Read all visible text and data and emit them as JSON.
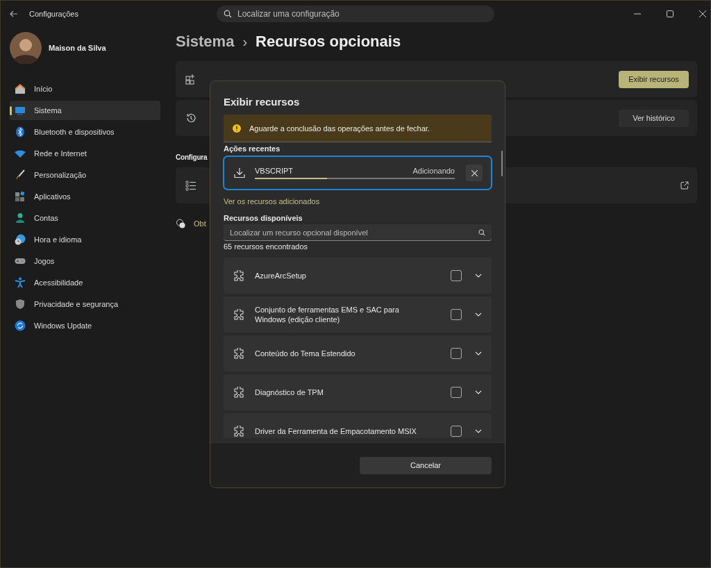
{
  "window": {
    "title": "Configurações",
    "search_placeholder": "Localizar uma configuração"
  },
  "user": {
    "name": "Maison da Silva"
  },
  "nav": [
    {
      "label": "Início",
      "selected": false
    },
    {
      "label": "Sistema",
      "selected": true
    },
    {
      "label": "Bluetooth e dispositivos",
      "selected": false
    },
    {
      "label": "Rede e Internet",
      "selected": false
    },
    {
      "label": "Personalização",
      "selected": false
    },
    {
      "label": "Aplicativos",
      "selected": false
    },
    {
      "label": "Contas",
      "selected": false
    },
    {
      "label": "Hora e idioma",
      "selected": false
    },
    {
      "label": "Jogos",
      "selected": false
    },
    {
      "label": "Acessibilidade",
      "selected": false
    },
    {
      "label": "Privacidade e segurança",
      "selected": false
    },
    {
      "label": "Windows Update",
      "selected": false
    }
  ],
  "breadcrumb": {
    "parent": "Sistema",
    "separator": "›",
    "current": "Recursos opcionais"
  },
  "cards": [
    {
      "kind": "add",
      "button": "Exibir recursos",
      "primary": true
    },
    {
      "kind": "history",
      "button": "Ver histórico",
      "primary": false
    }
  ],
  "section_heading": "Configura",
  "help_link": "Obt",
  "dialog": {
    "title": "Exibir recursos",
    "warning": "Aguarde a conclusão das operações antes de fechar.",
    "recent_heading": "Ações recentes",
    "recent": [
      {
        "name": "VBSCRIPT",
        "status": "Adicionando",
        "level": 0.36
      }
    ],
    "added_link": "Ver os recursos adicionados",
    "available_heading": "Recursos disponíveis",
    "search_placeholder": "Localizar um recurso opcional disponível",
    "count": "65 recursos encontrados",
    "features": [
      {
        "name": "AzureArcSetup",
        "checked": false
      },
      {
        "name": "Conjunto de ferramentas EMS e SAC para Windows (edição cliente)",
        "checked": false
      },
      {
        "name": "Conteúdo do Tema Estendido",
        "checked": false
      },
      {
        "name": "Diagnóstico de TPM",
        "checked": false
      },
      {
        "name": "Driver da Ferramenta de Empacotamento MSIX",
        "checked": false
      }
    ],
    "cancel": "Cancelar"
  }
}
